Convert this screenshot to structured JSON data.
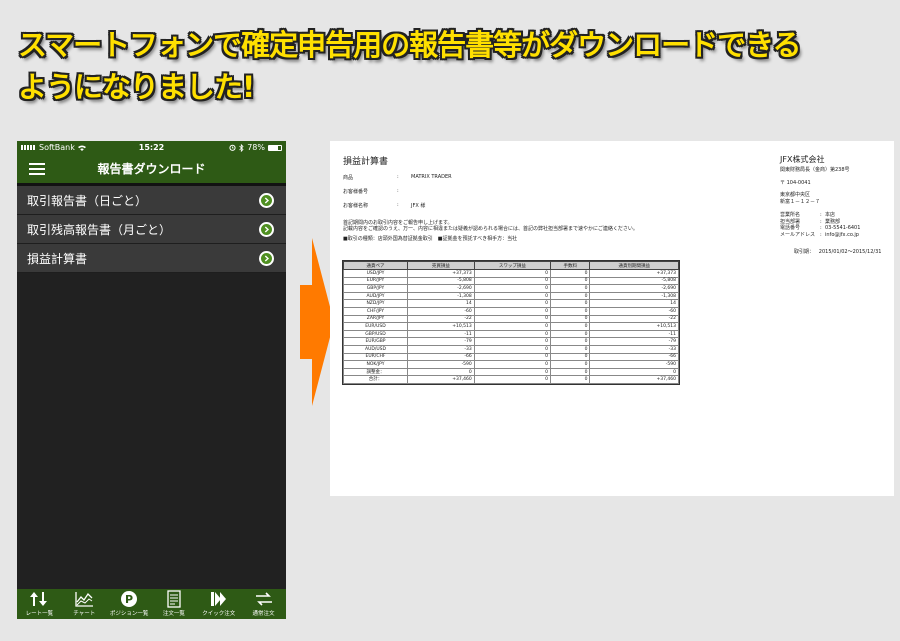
{
  "headline": {
    "line1": "スマートフォンで確定申告用の報告書等がダウンロードできる",
    "line2": "ようになりました!"
  },
  "phone": {
    "status": {
      "carrier": "SoftBank",
      "time": "15:22",
      "battery": "78%"
    },
    "nav_title": "報告書ダウンロード",
    "menu_items": [
      {
        "label": "取引報告書（日ごと）"
      },
      {
        "label": "取引残高報告書（月ごと）"
      },
      {
        "label": "損益計算書"
      }
    ],
    "tabs": [
      {
        "label": "レート一覧",
        "icon": "rate-list-icon"
      },
      {
        "label": "チャート",
        "icon": "chart-icon"
      },
      {
        "label": "ポジション一覧",
        "icon": "position-p-icon"
      },
      {
        "label": "注文一覧",
        "icon": "order-list-icon"
      },
      {
        "label": "クイック注文",
        "icon": "quick-order-icon"
      },
      {
        "label": "通常注文",
        "icon": "normal-order-icon"
      }
    ],
    "colors": {
      "accent": "#2e5a15",
      "menu_bg": "#3a3a3a",
      "screen_bg": "#212121",
      "go_button": "#4f8f21"
    }
  },
  "document": {
    "title": "損益計算書",
    "company": "JFX株式会社",
    "company_sub": "関東財務局長（金商）第238号",
    "postal": "〒 104-0041",
    "address1": "東京都中央区",
    "address2": "新富１－１２－７",
    "info": [
      {
        "key": "商品",
        "value": "MATRIX TRADER"
      },
      {
        "key": "お客様番号",
        "value": ""
      },
      {
        "key": "お客様名称",
        "value": "JFX 様"
      }
    ],
    "contact": [
      {
        "key": "営業所名",
        "value": "本店"
      },
      {
        "key": "担当部署",
        "value": "業務部"
      },
      {
        "key": "電話番号",
        "value": "03-5541-6401"
      },
      {
        "key": "メールアドレス",
        "value": "info@jfx.co.jp"
      }
    ],
    "notes": [
      "首記期間内のお取引内容をご報告申し上げます。",
      "記載内容をご確認のうえ、万一、内容に相違または疑義が認められる場合には、首記の弊社担当部署まで速やかにご連絡ください。"
    ],
    "legend": "■取引の種類：店頭外国為替証拠金取引　■証拠金を預託すべき相手方：当社",
    "period_label": "取引期：",
    "period": "2015/01/02～2015/12/31",
    "table": {
      "headers": [
        "通貨ペア",
        "売買損益",
        "スワップ損益",
        "手数料",
        "通貨別期間損益"
      ],
      "rows": [
        [
          "USD/JPY",
          "+37,373",
          "0",
          "0",
          "+37,373"
        ],
        [
          "EUR/JPY",
          "-5,808",
          "0",
          "0",
          "-5,808"
        ],
        [
          "GBP/JPY",
          "-2,690",
          "0",
          "0",
          "-2,690"
        ],
        [
          "AUD/JPY",
          "-1,308",
          "0",
          "0",
          "-1,308"
        ],
        [
          "NZD/JPY",
          "14",
          "0",
          "0",
          "14"
        ],
        [
          "CHF/JPY",
          "-60",
          "0",
          "0",
          "-60"
        ],
        [
          "ZAR/JPY",
          "-22",
          "0",
          "0",
          "-22"
        ],
        [
          "EUR/USD",
          "+10,513",
          "0",
          "0",
          "+10,513"
        ],
        [
          "GBP/USD",
          "-11",
          "0",
          "0",
          "-11"
        ],
        [
          "EUR/GBP",
          "-79",
          "0",
          "0",
          "-79"
        ],
        [
          "AUD/USD",
          "-33",
          "0",
          "0",
          "-33"
        ],
        [
          "EUR/CHF",
          "-66",
          "0",
          "0",
          "-66"
        ],
        [
          "NOK/JPY",
          "-590",
          "0",
          "0",
          "-590"
        ],
        [
          "調整金：",
          "0",
          "0",
          "0",
          "0"
        ],
        [
          "合計：",
          "+37,460",
          "0",
          "0",
          "+37,460"
        ]
      ]
    }
  },
  "colors": {
    "headline": "#ffe000",
    "arrow": "#ff7a00",
    "background": "#e6e6e6"
  }
}
